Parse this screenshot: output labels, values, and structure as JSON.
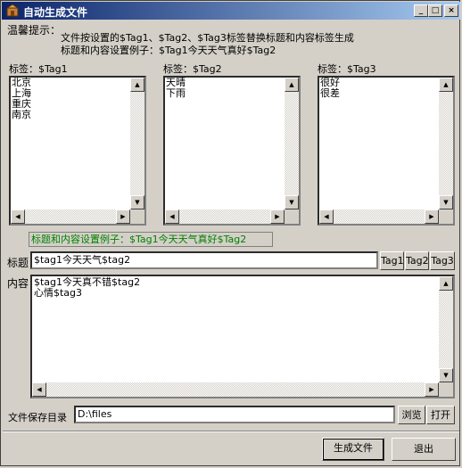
{
  "window": {
    "title": "自动生成文件",
    "controls": [
      "_",
      "□",
      "×"
    ]
  },
  "tip": {
    "heading": "温馨提示：",
    "line1": "文件按设置的$Tag1、$Tag2、$Tag3标签替换标题和内容标签生成",
    "line2": "标题和内容设置例子：$Tag1今天天气真好$Tag2"
  },
  "tags": [
    {
      "label": "标签：$Tag1",
      "items": [
        "北京",
        "上海",
        "重庆",
        "南京"
      ]
    },
    {
      "label": "标签：$Tag2",
      "items": [
        "天晴",
        "下雨"
      ]
    },
    {
      "label": "标签：$Tag3",
      "items": [
        "很好",
        "很差"
      ]
    }
  ],
  "example_text": "标题和内容设置例子：$Tag1今天天气真好$Tag2",
  "title_field": {
    "label": "标题",
    "value": "$tag1今天天气$tag2"
  },
  "tag_buttons": [
    "Tag1",
    "Tag2",
    "Tag3"
  ],
  "content_field": {
    "label": "内容",
    "lines": [
      "$tag1今天真不错$tag2",
      "心情$tag3"
    ]
  },
  "save_dir": {
    "label": "文件保存目录",
    "value": "D:\\files",
    "browse": "浏览",
    "open": "打开"
  },
  "actions": {
    "generate": "生成文件",
    "exit": "退出"
  }
}
